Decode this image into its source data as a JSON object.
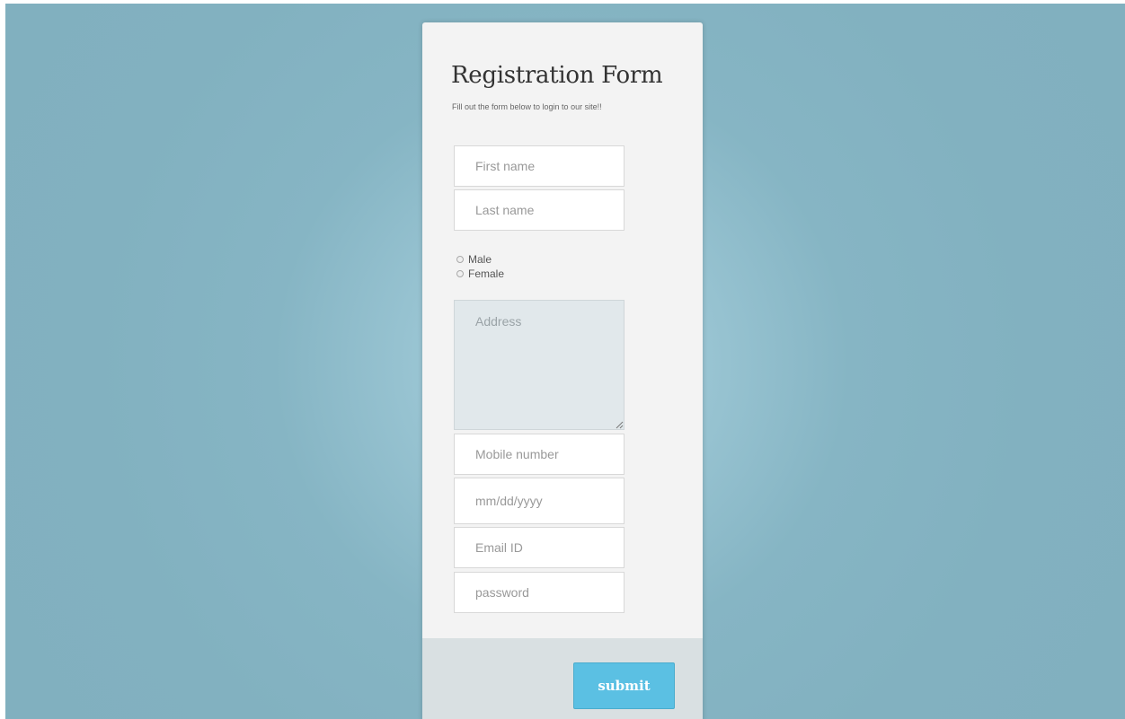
{
  "form": {
    "title": "Registration Form",
    "subtitle": "Fill out the form below to login to our site!!",
    "first_name": {
      "placeholder": "First name",
      "value": ""
    },
    "last_name": {
      "placeholder": "Last name",
      "value": ""
    },
    "gender": {
      "options": [
        {
          "label": "Male",
          "checked": false
        },
        {
          "label": "Female",
          "checked": false
        }
      ]
    },
    "address": {
      "placeholder": "Address",
      "value": ""
    },
    "mobile": {
      "placeholder": "Mobile number",
      "value": ""
    },
    "dob": {
      "placeholder": "mm/dd/yyyy",
      "value": ""
    },
    "email": {
      "placeholder": "Email ID",
      "value": ""
    },
    "password": {
      "placeholder": "password",
      "value": ""
    },
    "submit_label": "submit"
  },
  "colors": {
    "background": "#82b1c0",
    "card": "#f3f3f3",
    "footer": "#d9e0e2",
    "address_fill": "#e1e8eb",
    "accent": "#5bc0e3"
  }
}
